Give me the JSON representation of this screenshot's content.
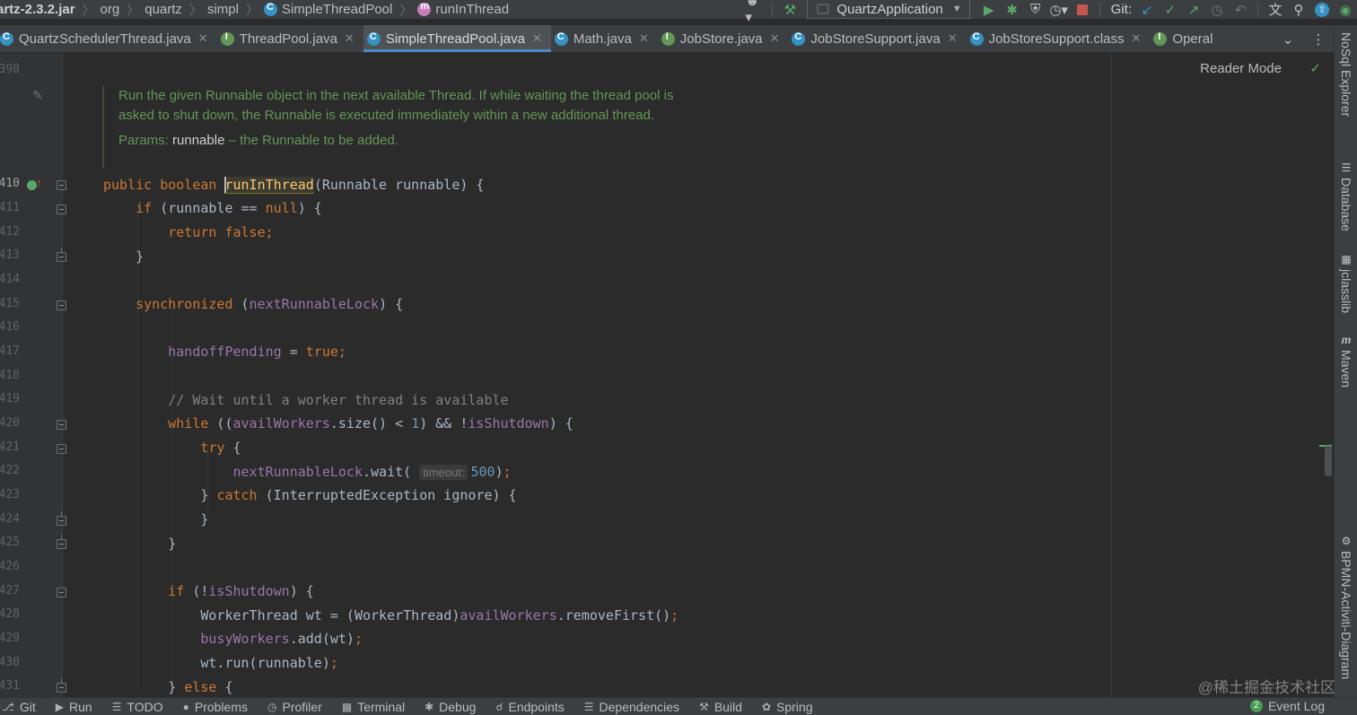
{
  "breadcrumbs": [
    {
      "label": "artz-2.3.2.jar",
      "icon": "jar-icon"
    },
    {
      "label": "org",
      "icon": "package-icon"
    },
    {
      "label": "quartz",
      "icon": "package-icon"
    },
    {
      "label": "simpl",
      "icon": "package-icon"
    },
    {
      "label": "SimpleThreadPool",
      "icon": "class-icon"
    },
    {
      "label": "runInThread",
      "icon": "method-icon"
    }
  ],
  "toolbar": {
    "run_config": "QuartzApplication",
    "git_label": "Git:"
  },
  "tabs": [
    {
      "label": "QuartzSchedulerThread.java",
      "icon": "class",
      "active": false
    },
    {
      "label": "ThreadPool.java",
      "icon": "iface",
      "active": false
    },
    {
      "label": "SimpleThreadPool.java",
      "icon": "class",
      "active": true
    },
    {
      "label": "Math.java",
      "icon": "class",
      "active": false
    },
    {
      "label": "JobStore.java",
      "icon": "iface",
      "active": false
    },
    {
      "label": "JobStoreSupport.java",
      "icon": "class",
      "active": false
    },
    {
      "label": "JobStoreSupport.class",
      "icon": "class",
      "active": false
    },
    {
      "label": "Operal",
      "icon": "iface",
      "active": false
    }
  ],
  "editor": {
    "reader_mode": "Reader Mode",
    "doc": {
      "line1": "Run the given Runnable object in the next available Thread. If while waiting the thread pool is",
      "line2": "asked to shut down, the Runnable is executed immediately within a new additional thread.",
      "params_label": "Params:",
      "param_name": "runnable",
      "param_desc": " – the Runnable to be added."
    },
    "line_numbers": [
      "398",
      "410",
      "411",
      "412",
      "413",
      "414",
      "415",
      "416",
      "417",
      "418",
      "419",
      "420",
      "421",
      "422",
      "423",
      "424",
      "425",
      "426",
      "427",
      "428",
      "429",
      "430",
      "431"
    ],
    "hint_timeout": "timeout:"
  },
  "right_tools": [
    {
      "label": "NoSql Explorer",
      "icon": "nosql-icon"
    },
    {
      "label": "Database",
      "icon": "database-icon"
    },
    {
      "label": "jclasslib",
      "icon": "jclasslib-icon"
    },
    {
      "label": "Maven",
      "icon": "maven-icon"
    },
    {
      "label": "BPMN-Activiti-Diagram",
      "icon": "bpmn-icon"
    }
  ],
  "bottom_tools": [
    {
      "label": "Git",
      "icon": "git-icon"
    },
    {
      "label": "Run",
      "icon": "run-icon"
    },
    {
      "label": "TODO",
      "icon": "todo-icon"
    },
    {
      "label": "Problems",
      "icon": "problems-icon"
    },
    {
      "label": "Profiler",
      "icon": "profiler-icon"
    },
    {
      "label": "Terminal",
      "icon": "terminal-icon"
    },
    {
      "label": "Debug",
      "icon": "debug-icon"
    },
    {
      "label": "Endpoints",
      "icon": "endpoints-icon"
    },
    {
      "label": "Dependencies",
      "icon": "dependencies-icon"
    },
    {
      "label": "Build",
      "icon": "build-icon"
    },
    {
      "label": "Spring",
      "icon": "spring-icon"
    }
  ],
  "event_log": {
    "count": "2",
    "label": "Event Log"
  },
  "watermark": "@稀土掘金技术社区",
  "colors": {
    "keyword": "#cc7832",
    "method": "#ffc66d",
    "field": "#9876aa",
    "number": "#6897bb",
    "doc": "#629755",
    "accent": "#4a88c7"
  }
}
